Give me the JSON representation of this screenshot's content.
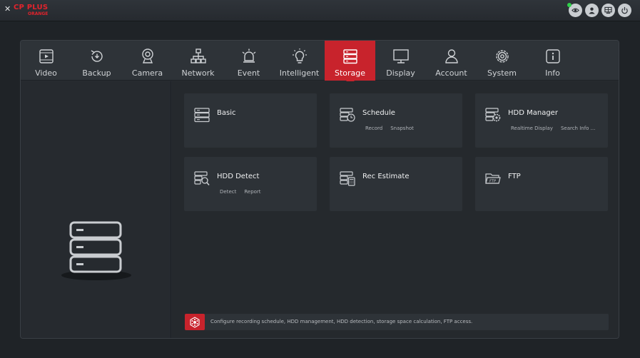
{
  "header": {
    "logo_mark": "✕",
    "logo_brand": "CP PLUS",
    "logo_sub": "ORANGE",
    "icons": [
      "eye-icon",
      "user-icon",
      "monitor-grid-icon",
      "power-icon"
    ]
  },
  "tabs": [
    {
      "label": "Video",
      "icon": "video-icon"
    },
    {
      "label": "Backup",
      "icon": "backup-icon"
    },
    {
      "label": "Camera",
      "icon": "camera-icon"
    },
    {
      "label": "Network",
      "icon": "network-icon"
    },
    {
      "label": "Event",
      "icon": "alarm-icon"
    },
    {
      "label": "Intelligent",
      "icon": "bulb-icon"
    },
    {
      "label": "Storage",
      "icon": "storage-icon",
      "active": true
    },
    {
      "label": "Display",
      "icon": "display-icon"
    },
    {
      "label": "Account",
      "icon": "account-icon"
    },
    {
      "label": "System",
      "icon": "gear-icon"
    },
    {
      "label": "Info",
      "icon": "info-icon"
    }
  ],
  "cards": [
    {
      "title": "Basic",
      "icon": "storage-basic-icon",
      "subs": []
    },
    {
      "title": "Schedule",
      "icon": "schedule-icon",
      "subs": [
        "Record",
        "Snapshot"
      ]
    },
    {
      "title": "HDD Manager",
      "icon": "hdd-manager-icon",
      "subs": [
        "Realtime Display",
        "Search Info ..."
      ]
    },
    {
      "title": "HDD Detect",
      "icon": "hdd-detect-icon",
      "subs": [
        "Detect",
        "Report"
      ]
    },
    {
      "title": "Rec Estimate",
      "icon": "rec-estimate-icon",
      "subs": []
    },
    {
      "title": "FTP",
      "icon": "ftp-folder-icon",
      "subs": []
    }
  ],
  "description": "Configure recording schedule, HDD management, HDD detection, storage space calculation, FTP access.",
  "colors": {
    "accent": "#c8232c",
    "background": "#1f2327",
    "panel": "#2d3237"
  }
}
